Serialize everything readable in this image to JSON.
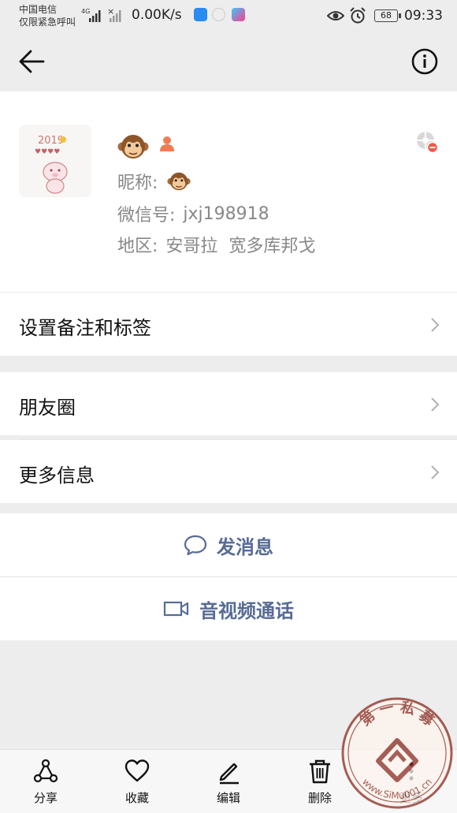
{
  "status_bar": {
    "carrier": "中国电信",
    "carrier_sub": "仅限紧急呼叫",
    "network": "4G",
    "speed": "0.00K/s",
    "battery": "68",
    "time": "09:33"
  },
  "nav": {
    "back_icon": "arrow-left-icon",
    "info_icon": "info-circle-icon"
  },
  "profile": {
    "nickname_label": "昵称:",
    "wechat_id_label": "微信号:",
    "wechat_id": "jxj198918",
    "region_label": "地区:",
    "region": "安哥拉  宽多库邦戈",
    "avatar_text": "2019"
  },
  "menu": {
    "remarks": "设置备注和标签",
    "moments": "朋友圈",
    "more_info": "更多信息"
  },
  "actions": {
    "send_message": "发消息",
    "video_call": "音视频通话"
  },
  "toolbar": {
    "share": "分享",
    "favorite": "收藏",
    "edit": "编辑",
    "delete": "删除",
    "more": "更多"
  },
  "watermark": {
    "top_text": "第 一 私 募",
    "bottom_text": "www.SiMu001.cn"
  },
  "colors": {
    "link_blue": "#576b95",
    "background": "#ededed",
    "card": "#ffffff"
  }
}
